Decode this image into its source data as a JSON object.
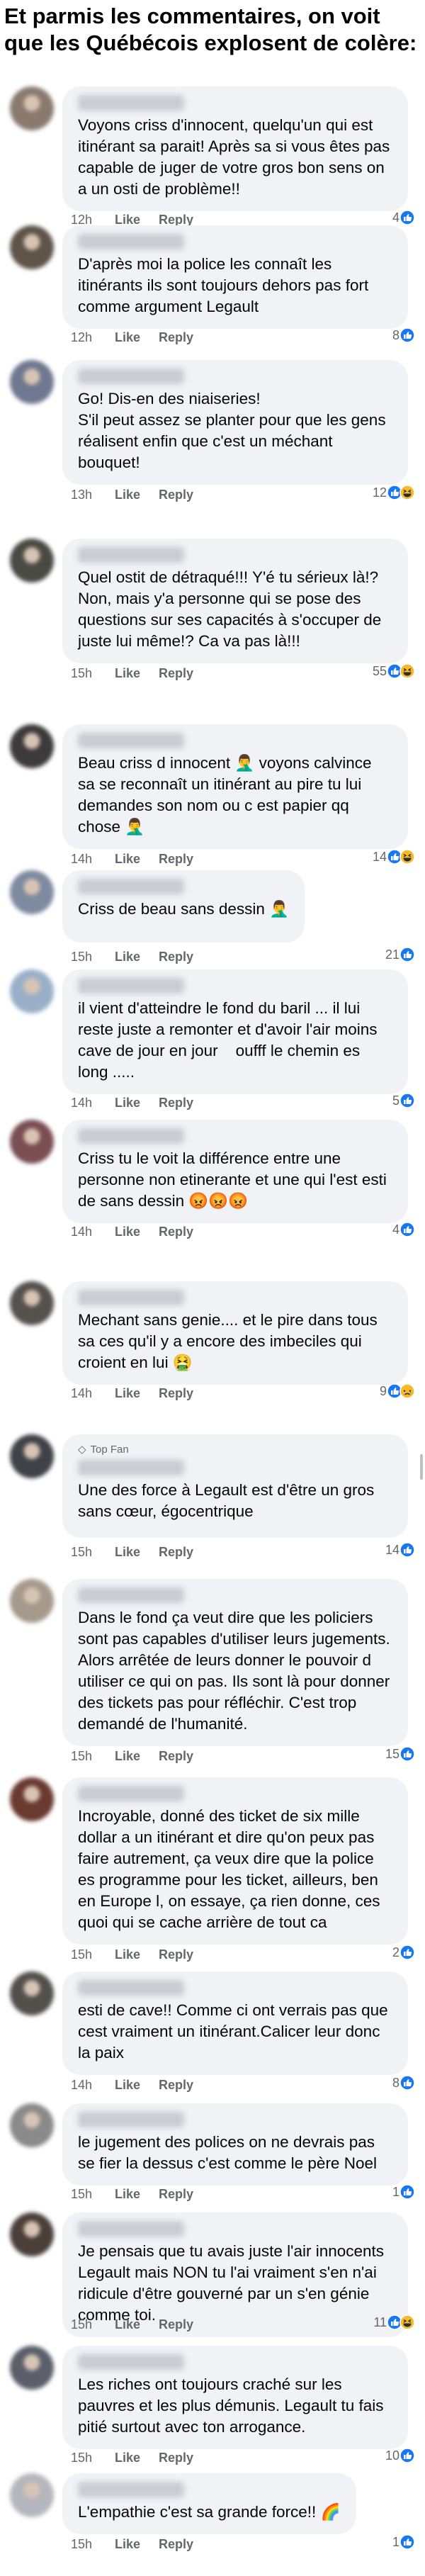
{
  "headline": "Et parmis les commentaires, on voit que les Québécois explosent de colère:",
  "action_labels": {
    "like": "Like",
    "reply": "Reply"
  },
  "top_fan_label": "Top Fan",
  "comments": [
    {
      "text": "Voyons criss d'innocent, quelqu'un qui est itinérant sa parait! Après sa si vous êtes pas capable de juger de votre gros bon sens on a un osti de problème!!",
      "time": "12h",
      "count": "4",
      "reactions": [
        "like"
      ],
      "avatar_color": "#8a7a6e"
    },
    {
      "text": "D'après moi la police les connaît les itinérants ils sont toujours dehors pas fort comme argument Legault",
      "time": "12h",
      "count": "8",
      "reactions": [
        "like"
      ],
      "avatar_color": "#5e5448"
    },
    {
      "text": "Go! Dis-en des niaiseries!\nS'il peut assez se planter pour que les gens réalisent enfin que c'est un méchant bouquet!",
      "time": "13h",
      "count": "12",
      "reactions": [
        "like",
        "haha"
      ],
      "avatar_color": "#6f7890"
    },
    {
      "text": "Quel ostit de détraqué!!! Y'é tu sérieux là!? Non, mais y'a personne qui se pose des questions sur ses capacités à s'occuper de juste lui même!? Ca va pas là!!!",
      "time": "15h",
      "count": "55",
      "reactions": [
        "like",
        "haha"
      ],
      "avatar_color": "#4a4a44"
    },
    {
      "text": "Beau criss d innocent 🤦‍♂️ voyons calvince sa se reconnaît un itinérant au pire tu lui demandes son nom ou c est papier qq chose 🤦‍♂️",
      "time": "14h",
      "count": "14",
      "reactions": [
        "like",
        "haha"
      ],
      "avatar_color": "#3c3a3a"
    },
    {
      "text": "Criss de beau sans dessin 🤦‍♂️",
      "time": "15h",
      "count": "21",
      "reactions": [
        "like"
      ],
      "avatar_color": "#7d8aa0"
    },
    {
      "text": "il vient d'atteindre le fond du baril ... il lui reste juste a remonter et d'avoir l'air moins cave de jour en jour    oufff le chemin es long .....",
      "time": "14h",
      "count": "5",
      "reactions": [
        "like"
      ],
      "avatar_color": "#9ab0c8"
    },
    {
      "text": "Criss tu le voit la différence entre une personne non etinerante et une qui l'est esti de sans dessin 😡😡😡",
      "time": "14h",
      "count": "4",
      "reactions": [
        "like"
      ],
      "avatar_color": "#7a4e52"
    },
    {
      "text": "Mechant sans genie.... et le pire dans tous sa ces qu'il y a encore des imbeciles qui croient en lui 🤮",
      "time": "14h",
      "count": "9",
      "reactions": [
        "like",
        "sad"
      ],
      "avatar_color": "#55514d"
    },
    {
      "text": "Une des force à Legault est d'être un gros sans cœur, égocentrique",
      "time": "15h",
      "count": "14",
      "reactions": [
        "like"
      ],
      "avatar_color": "#3f4248",
      "top_fan": true
    },
    {
      "text": "Dans le fond ça veut dire que les policiers sont pas capables d'utiliser leurs jugements. Alors arrêtée de leurs donner le pouvoir d utiliser ce qui on pas. Ils sont là pour donner des tickets pas pour réfléchir. C'est trop demandé de l'humanité.",
      "time": "15h",
      "count": "15",
      "reactions": [
        "like"
      ],
      "avatar_color": "#a69a8c"
    },
    {
      "text": "Incroyable, donné des ticket de six mille dollar a un itinérant et dire qu'on peux pas faire autrement, ça veux dire que la police es programme pour les ticket, ailleurs, ben en Europe l, on essaye, ça rien donne, ces quoi qui se cache arrière de tout ca",
      "time": "15h",
      "count": "2",
      "reactions": [
        "like"
      ],
      "avatar_color": "#6a3a30"
    },
    {
      "text": "esti de cave!! Comme ci ont verrais pas que cest vraiment un itinérant.Calicer leur donc la paix",
      "time": "14h",
      "count": "8",
      "reactions": [
        "like"
      ],
      "avatar_color": "#53504c"
    },
    {
      "text": "le jugement des polices on ne devrais pas se fier la dessus c'est comme le père Noel",
      "time": "15h",
      "count": "1",
      "reactions": [
        "like"
      ],
      "avatar_color": "#8a8a8a"
    },
    {
      "text": "Je pensais que tu avais juste l'air innocents Legault mais NON tu l'ai vraiment s'en n'ai ridicule d'être gouverné par un s'en génie comme toi.",
      "time": "15h",
      "count": "11",
      "reactions": [
        "like",
        "haha"
      ],
      "avatar_color": "#4b3f3a"
    },
    {
      "text": "Les riches ont toujours craché sur les pauvres et les plus démunis. Legault tu fais pitié surtout avec ton arrogance.",
      "time": "15h",
      "count": "10",
      "reactions": [
        "like"
      ],
      "avatar_color": "#5a5f6a"
    },
    {
      "text": "L'empathie c'est sa grande force!! 🌈",
      "time": "15h",
      "count": "1",
      "reactions": [
        "like"
      ],
      "avatar_color": "#b4b7bd"
    }
  ],
  "colors": {
    "bubble": "#f0f2f5",
    "meta_text": "#65676b",
    "like_blue": "#1877f2",
    "haha_yellow": "#f7b928"
  }
}
